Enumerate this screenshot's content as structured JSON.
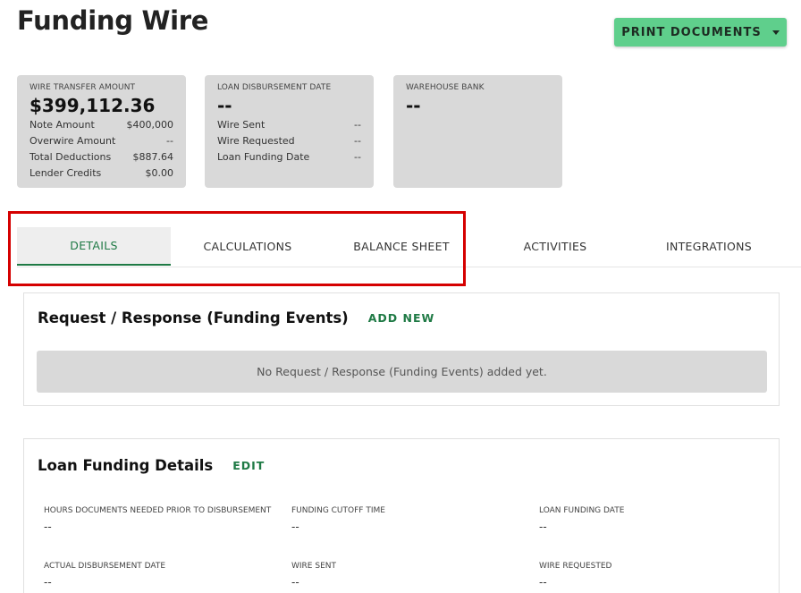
{
  "header": {
    "title": "Funding Wire",
    "print_label": "PRINT DOCUMENTS"
  },
  "cards": {
    "wire": {
      "label": "WIRE TRANSFER AMOUNT",
      "value": "$399,112.36",
      "rows": [
        {
          "label": "Note Amount",
          "value": "$400,000"
        },
        {
          "label": "Overwire Amount",
          "value": "--"
        },
        {
          "label": "Total Deductions",
          "value": "$887.64"
        },
        {
          "label": "Lender Credits",
          "value": "$0.00"
        }
      ]
    },
    "disbursement": {
      "label": "LOAN DISBURSEMENT DATE",
      "value": "--",
      "rows": [
        {
          "label": "Wire Sent",
          "value": "--"
        },
        {
          "label": "Wire Requested",
          "value": "--"
        },
        {
          "label": "Loan Funding Date",
          "value": "--"
        }
      ]
    },
    "warehouse": {
      "label": "WAREHOUSE BANK",
      "value": "--"
    }
  },
  "tabs": [
    "DETAILS",
    "CALCULATIONS",
    "BALANCE SHEET",
    "ACTIVITIES",
    "INTEGRATIONS"
  ],
  "events_panel": {
    "title": "Request / Response (Funding Events)",
    "action": "ADD NEW",
    "empty_text": "No Request / Response (Funding Events) added yet."
  },
  "details_panel": {
    "title": "Loan Funding Details",
    "action": "EDIT",
    "fields": [
      {
        "label": "HOURS DOCUMENTS NEEDED PRIOR TO DISBURSEMENT",
        "value": "--"
      },
      {
        "label": "FUNDING CUTOFF TIME",
        "value": "--"
      },
      {
        "label": "LOAN FUNDING DATE",
        "value": "--"
      },
      {
        "label": "ACTUAL DISBURSEMENT DATE",
        "value": "--"
      },
      {
        "label": "WIRE SENT",
        "value": "--"
      },
      {
        "label": "WIRE REQUESTED",
        "value": "--"
      }
    ]
  },
  "colors": {
    "accent": "#1f7a45",
    "button": "#5fcf8c",
    "card": "#d9d9d9",
    "highlight": "#d50000"
  }
}
